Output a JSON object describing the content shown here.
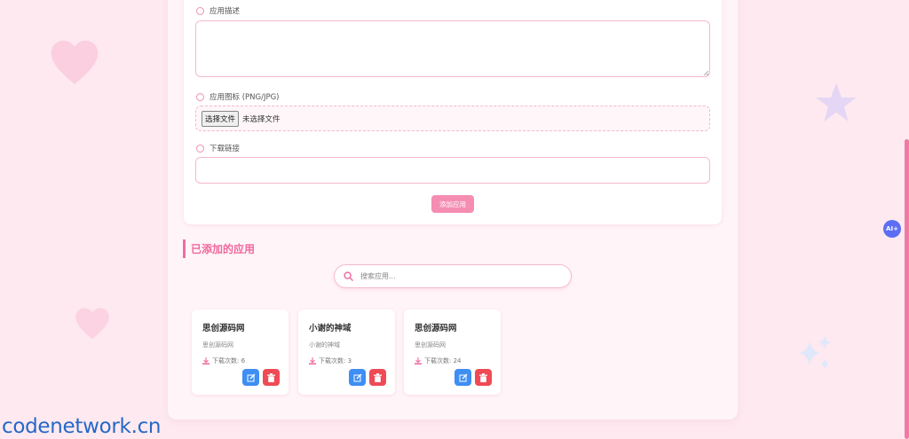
{
  "form": {
    "description_label": "应用描述",
    "icon_label": "应用图标 (PNG/JPG)",
    "file_button": "选择文件",
    "file_status": "未选择文件",
    "link_label": "下载链接",
    "submit_label": "添加应用"
  },
  "apps_section": {
    "title": "已添加的应用",
    "search_placeholder": "搜索应用..."
  },
  "apps": [
    {
      "name": "思创源码网",
      "desc": "思创源码网",
      "downloads": "下载次数: 6"
    },
    {
      "name": "小谢的神域",
      "desc": "小谢的神域",
      "downloads": "下载次数: 3"
    },
    {
      "name": "思创源码网",
      "desc": "思创源码网",
      "downloads": "下载次数: 24"
    }
  ],
  "ai_badge": "AI+",
  "watermark": "codenetwork.cn",
  "colors": {
    "accent": "#f06c9f",
    "edit": "#3e8ef3",
    "delete": "#ef4a55"
  }
}
